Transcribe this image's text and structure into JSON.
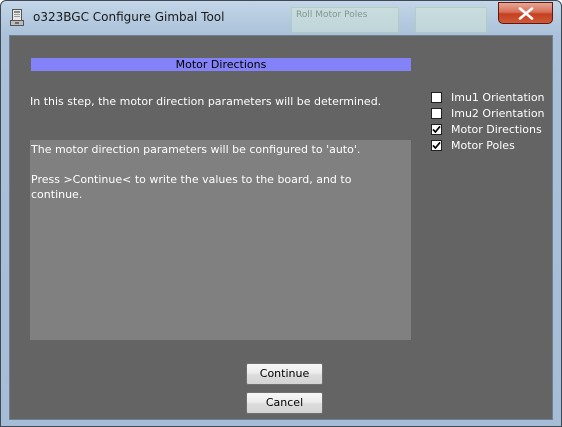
{
  "window": {
    "title": "o323BGC Configure Gimbal Tool",
    "background_tabs": [
      {
        "label": "Roll Motor Poles"
      },
      {
        "label": ""
      }
    ]
  },
  "titlebar_buttons": {
    "close_icon": "close-x"
  },
  "main": {
    "section_header": "Motor Directions",
    "intro_text": "In this step, the motor direction parameters will be determined.",
    "message_lines": [
      "The motor direction parameters will be configured to 'auto'.",
      "",
      "Press >Continue< to write the values to the board, and to",
      "continue."
    ]
  },
  "steps": [
    {
      "label": "Imu1 Orientation",
      "checked": false
    },
    {
      "label": "Imu2 Orientation",
      "checked": false
    },
    {
      "label": "Motor Directions",
      "checked": true
    },
    {
      "label": "Motor Poles",
      "checked": true
    }
  ],
  "buttons": {
    "continue_label": "Continue",
    "cancel_label": "Cancel"
  },
  "colors": {
    "client_background": "#646464",
    "message_background": "#808080",
    "section_header_background": "#8482f8",
    "close_button": "#c4401f"
  }
}
